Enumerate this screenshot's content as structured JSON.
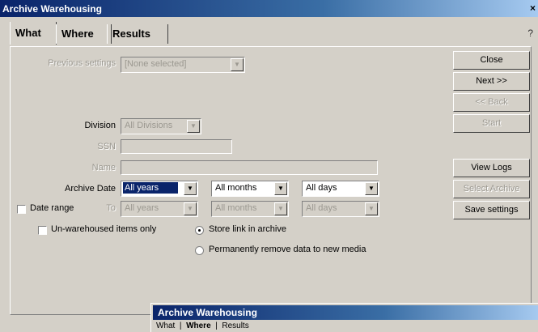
{
  "window": {
    "title": "Archive Warehousing",
    "close_glyph": "×",
    "help_glyph": "?"
  },
  "tabs": [
    {
      "label": "What",
      "active": true
    },
    {
      "label": "Where",
      "active": false
    },
    {
      "label": "Results",
      "active": false
    }
  ],
  "form": {
    "previous_settings": {
      "label": "Previous settings",
      "value": "[None selected]"
    },
    "division": {
      "label": "Division",
      "value": "All Divisions"
    },
    "ssn": {
      "label": "SSN",
      "value": ""
    },
    "name": {
      "label": "Name",
      "value": ""
    },
    "archive_date": {
      "label": "Archive Date",
      "year": "All years",
      "month": "All months",
      "day": "All days"
    },
    "date_range": {
      "label": "Date range",
      "checked": false
    },
    "to": {
      "label": "To",
      "year": "All years",
      "month": "All months",
      "day": "All days"
    },
    "unwarehoused": {
      "label": "Un-warehoused items only",
      "checked": false
    },
    "store_link": {
      "label": "Store link in archive",
      "selected": true
    },
    "permanently_remove": {
      "label": "Permanently remove data to new media",
      "selected": false
    }
  },
  "buttons": {
    "close": "Close",
    "next": "Next >>",
    "back": "<< Back",
    "start": "Start",
    "view_logs": "View Logs",
    "select_archive": "Select Archive",
    "save_settings": "Save settings"
  },
  "second_window": {
    "title": "Archive Warehousing",
    "tabs": [
      "What",
      "Where",
      "Results"
    ]
  },
  "icons": {
    "dropdown": "chevron-down-icon"
  },
  "colors": {
    "title_start": "#0a246a",
    "title_end": "#a6caf0",
    "face": "#d4d0c8",
    "selection": "#0a246a"
  }
}
